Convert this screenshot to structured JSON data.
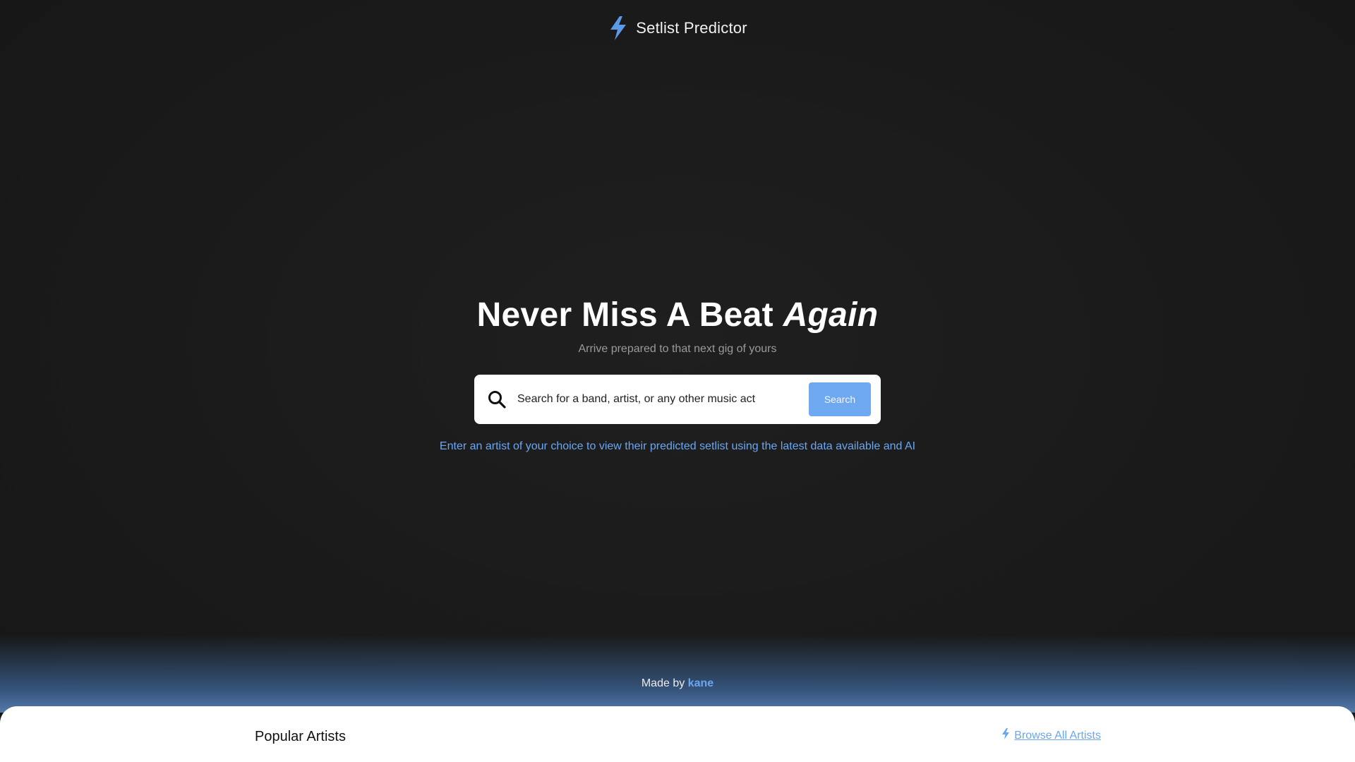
{
  "brand": {
    "name": "Setlist Predictor",
    "logo_icon": "lightning-bolt-icon",
    "accent": "#6aa6f2"
  },
  "hero": {
    "title_main": "Never Miss A Beat",
    "title_emphasis": "Again",
    "subtitle": "Arrive prepared to that next gig of yours"
  },
  "search": {
    "icon": "search-icon",
    "placeholder": "Search for a band, artist, or any other music act",
    "button_label": "Search"
  },
  "hint": "Enter an artist of your choice to view their predicted setlist using the latest data available and AI",
  "footer": {
    "made_by_prefix": "Made by",
    "author": "kane"
  },
  "panel": {
    "title": "Popular Artists",
    "browse_label": "Browse All Artists",
    "browse_icon": "lightning-bolt-icon"
  }
}
